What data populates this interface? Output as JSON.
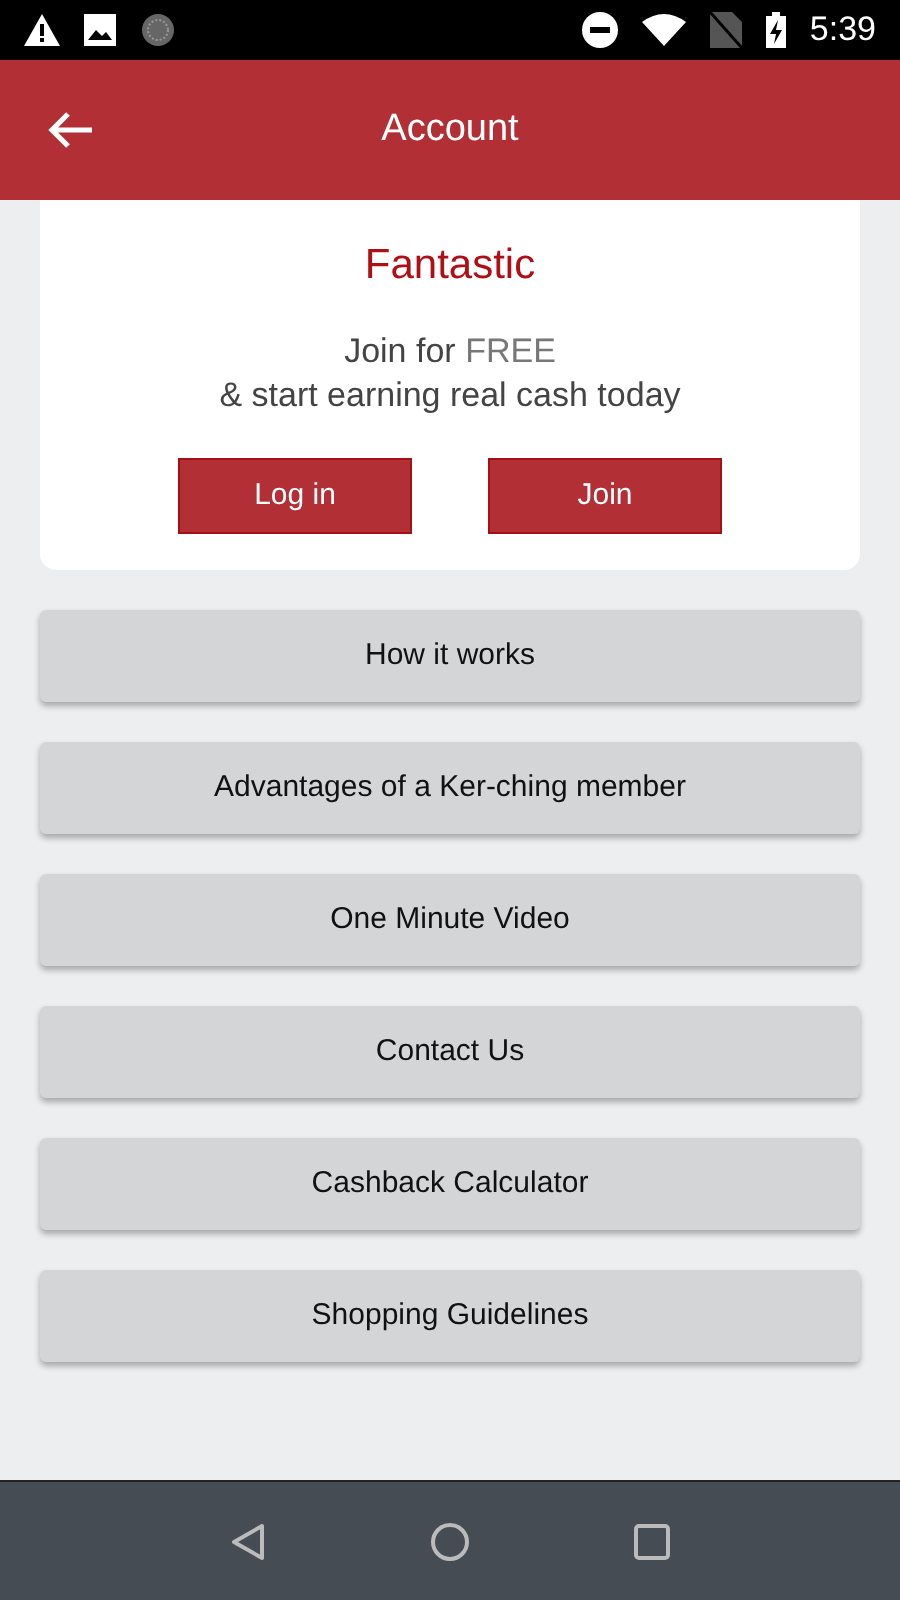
{
  "status_bar": {
    "time": "5:39"
  },
  "header": {
    "title": "Account"
  },
  "promo": {
    "title": "Fantastic",
    "line1_prefix": "Join for",
    "line1_highlight": "FREE",
    "line2": "& start earning real cash today",
    "buttons": [
      "Log in",
      "Join"
    ]
  },
  "menu": [
    "How it works",
    "Advantages of a Ker-ching member",
    "One Minute Video",
    "Contact Us",
    "Cashback Calculator",
    "Shopping Guidelines"
  ]
}
